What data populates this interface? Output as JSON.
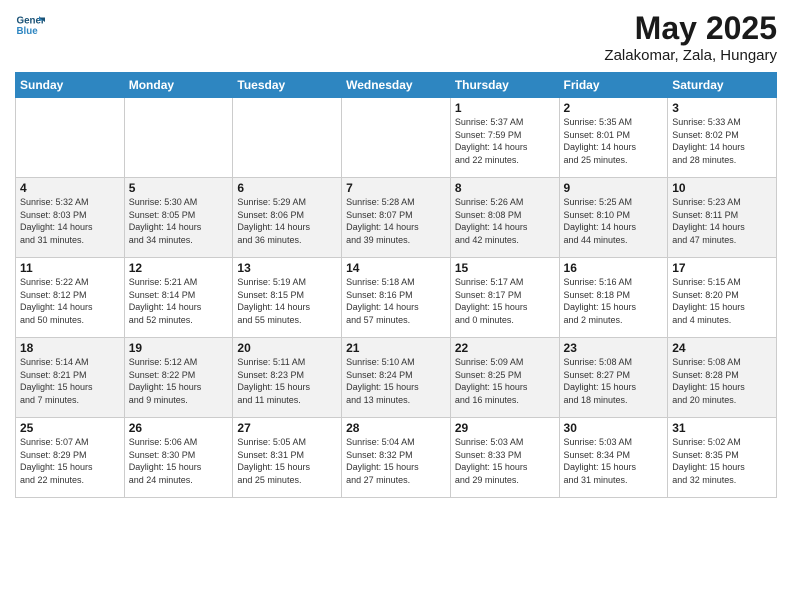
{
  "logo": {
    "line1": "General",
    "line2": "Blue"
  },
  "header": {
    "month": "May 2025",
    "location": "Zalakomar, Zala, Hungary"
  },
  "weekdays": [
    "Sunday",
    "Monday",
    "Tuesday",
    "Wednesday",
    "Thursday",
    "Friday",
    "Saturday"
  ],
  "weeks": [
    [
      {
        "day": "",
        "info": ""
      },
      {
        "day": "",
        "info": ""
      },
      {
        "day": "",
        "info": ""
      },
      {
        "day": "",
        "info": ""
      },
      {
        "day": "1",
        "info": "Sunrise: 5:37 AM\nSunset: 7:59 PM\nDaylight: 14 hours\nand 22 minutes."
      },
      {
        "day": "2",
        "info": "Sunrise: 5:35 AM\nSunset: 8:01 PM\nDaylight: 14 hours\nand 25 minutes."
      },
      {
        "day": "3",
        "info": "Sunrise: 5:33 AM\nSunset: 8:02 PM\nDaylight: 14 hours\nand 28 minutes."
      }
    ],
    [
      {
        "day": "4",
        "info": "Sunrise: 5:32 AM\nSunset: 8:03 PM\nDaylight: 14 hours\nand 31 minutes."
      },
      {
        "day": "5",
        "info": "Sunrise: 5:30 AM\nSunset: 8:05 PM\nDaylight: 14 hours\nand 34 minutes."
      },
      {
        "day": "6",
        "info": "Sunrise: 5:29 AM\nSunset: 8:06 PM\nDaylight: 14 hours\nand 36 minutes."
      },
      {
        "day": "7",
        "info": "Sunrise: 5:28 AM\nSunset: 8:07 PM\nDaylight: 14 hours\nand 39 minutes."
      },
      {
        "day": "8",
        "info": "Sunrise: 5:26 AM\nSunset: 8:08 PM\nDaylight: 14 hours\nand 42 minutes."
      },
      {
        "day": "9",
        "info": "Sunrise: 5:25 AM\nSunset: 8:10 PM\nDaylight: 14 hours\nand 44 minutes."
      },
      {
        "day": "10",
        "info": "Sunrise: 5:23 AM\nSunset: 8:11 PM\nDaylight: 14 hours\nand 47 minutes."
      }
    ],
    [
      {
        "day": "11",
        "info": "Sunrise: 5:22 AM\nSunset: 8:12 PM\nDaylight: 14 hours\nand 50 minutes."
      },
      {
        "day": "12",
        "info": "Sunrise: 5:21 AM\nSunset: 8:14 PM\nDaylight: 14 hours\nand 52 minutes."
      },
      {
        "day": "13",
        "info": "Sunrise: 5:19 AM\nSunset: 8:15 PM\nDaylight: 14 hours\nand 55 minutes."
      },
      {
        "day": "14",
        "info": "Sunrise: 5:18 AM\nSunset: 8:16 PM\nDaylight: 14 hours\nand 57 minutes."
      },
      {
        "day": "15",
        "info": "Sunrise: 5:17 AM\nSunset: 8:17 PM\nDaylight: 15 hours\nand 0 minutes."
      },
      {
        "day": "16",
        "info": "Sunrise: 5:16 AM\nSunset: 8:18 PM\nDaylight: 15 hours\nand 2 minutes."
      },
      {
        "day": "17",
        "info": "Sunrise: 5:15 AM\nSunset: 8:20 PM\nDaylight: 15 hours\nand 4 minutes."
      }
    ],
    [
      {
        "day": "18",
        "info": "Sunrise: 5:14 AM\nSunset: 8:21 PM\nDaylight: 15 hours\nand 7 minutes."
      },
      {
        "day": "19",
        "info": "Sunrise: 5:12 AM\nSunset: 8:22 PM\nDaylight: 15 hours\nand 9 minutes."
      },
      {
        "day": "20",
        "info": "Sunrise: 5:11 AM\nSunset: 8:23 PM\nDaylight: 15 hours\nand 11 minutes."
      },
      {
        "day": "21",
        "info": "Sunrise: 5:10 AM\nSunset: 8:24 PM\nDaylight: 15 hours\nand 13 minutes."
      },
      {
        "day": "22",
        "info": "Sunrise: 5:09 AM\nSunset: 8:25 PM\nDaylight: 15 hours\nand 16 minutes."
      },
      {
        "day": "23",
        "info": "Sunrise: 5:08 AM\nSunset: 8:27 PM\nDaylight: 15 hours\nand 18 minutes."
      },
      {
        "day": "24",
        "info": "Sunrise: 5:08 AM\nSunset: 8:28 PM\nDaylight: 15 hours\nand 20 minutes."
      }
    ],
    [
      {
        "day": "25",
        "info": "Sunrise: 5:07 AM\nSunset: 8:29 PM\nDaylight: 15 hours\nand 22 minutes."
      },
      {
        "day": "26",
        "info": "Sunrise: 5:06 AM\nSunset: 8:30 PM\nDaylight: 15 hours\nand 24 minutes."
      },
      {
        "day": "27",
        "info": "Sunrise: 5:05 AM\nSunset: 8:31 PM\nDaylight: 15 hours\nand 25 minutes."
      },
      {
        "day": "28",
        "info": "Sunrise: 5:04 AM\nSunset: 8:32 PM\nDaylight: 15 hours\nand 27 minutes."
      },
      {
        "day": "29",
        "info": "Sunrise: 5:03 AM\nSunset: 8:33 PM\nDaylight: 15 hours\nand 29 minutes."
      },
      {
        "day": "30",
        "info": "Sunrise: 5:03 AM\nSunset: 8:34 PM\nDaylight: 15 hours\nand 31 minutes."
      },
      {
        "day": "31",
        "info": "Sunrise: 5:02 AM\nSunset: 8:35 PM\nDaylight: 15 hours\nand 32 minutes."
      }
    ]
  ]
}
